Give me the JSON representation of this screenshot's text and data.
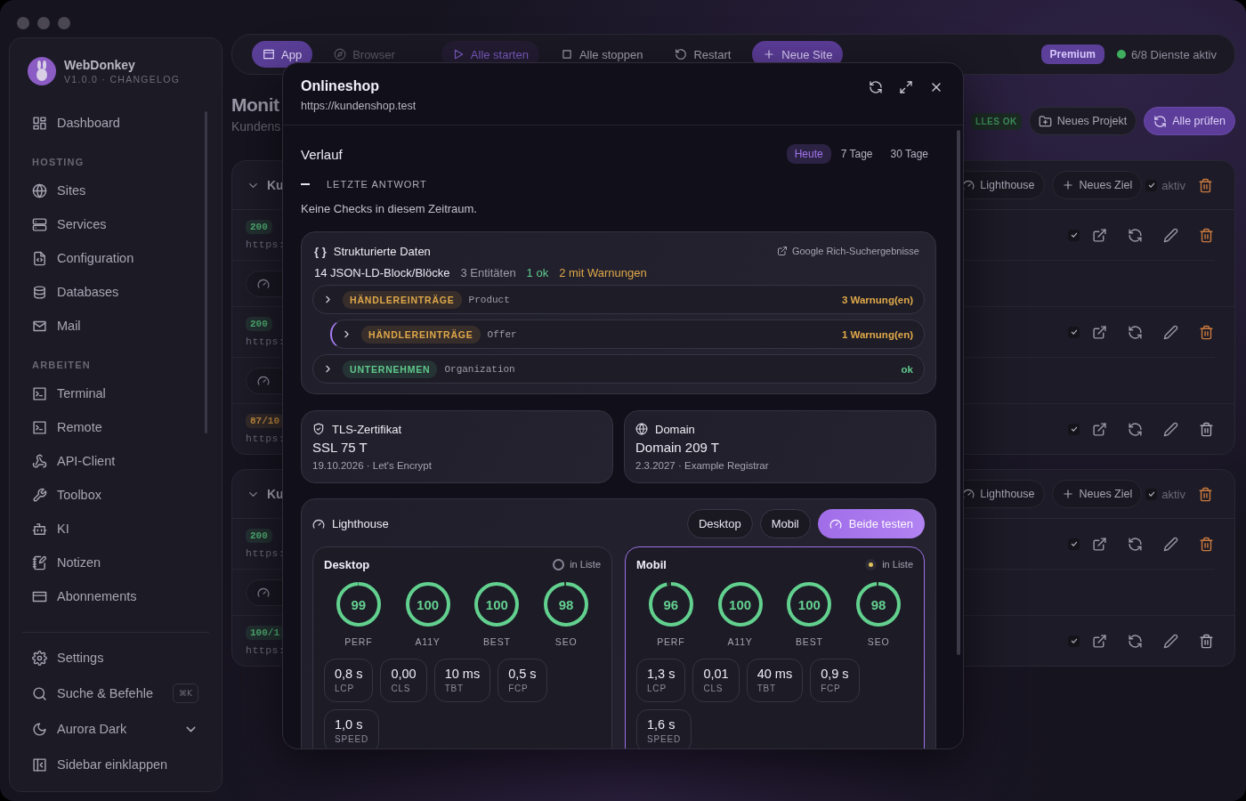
{
  "sidebar": {
    "app_name": "WebDonkey",
    "version": "V1.0.0 · CHANGELOG",
    "sections": [
      {
        "items": [
          {
            "label": "Dashboard"
          }
        ]
      },
      {
        "title": "HOSTING",
        "items": [
          {
            "label": "Sites"
          },
          {
            "label": "Services"
          },
          {
            "label": "Configuration"
          },
          {
            "label": "Databases"
          },
          {
            "label": "Mail"
          }
        ]
      },
      {
        "title": "ARBEITEN",
        "items": [
          {
            "label": "Terminal"
          },
          {
            "label": "Remote"
          },
          {
            "label": "API-Client"
          },
          {
            "label": "Toolbox"
          },
          {
            "label": "KI"
          },
          {
            "label": "Notizen"
          },
          {
            "label": "Abonnements"
          }
        ]
      }
    ],
    "footer": [
      {
        "label": "Settings"
      },
      {
        "label": "Suche & Befehle",
        "shortcut": "⌘K"
      },
      {
        "label": "Aurora Dark",
        "dropdown": true
      },
      {
        "label": "Sidebar einklappen"
      }
    ]
  },
  "toolbar": {
    "segments": [
      {
        "label": "App",
        "selected": true
      },
      {
        "label": "Browser",
        "selected": false
      }
    ],
    "actions": [
      {
        "label": "Alle starten",
        "kind": "accent"
      },
      {
        "label": "Alle stoppen",
        "kind": "plain"
      },
      {
        "label": "Restart",
        "kind": "plain"
      },
      {
        "label": "Neue Site",
        "kind": "primary"
      }
    ],
    "plan": "Premium",
    "services": "6/8 Dienste aktiv"
  },
  "page": {
    "title": "Monit",
    "subtitle": "Kundens",
    "status": "LLES OK",
    "buttons": [
      {
        "label": "Neues Projekt",
        "kind": "outline"
      },
      {
        "label": "Alle prüfen",
        "kind": "primary"
      }
    ]
  },
  "groups": [
    {
      "title": "Ku",
      "lighthouse": "Lighthouse",
      "new_target": "Neues Ziel",
      "active_label": "aktiv",
      "active": true,
      "rows": [
        {
          "badge": {
            "text": "200",
            "color": "#4fae72"
          },
          "url": "https:",
          "meter_button": true,
          "checked": true,
          "trash": {
            "color": "#c97a3f"
          }
        },
        {
          "badge": {
            "text": "200",
            "color": "#4fae72"
          },
          "url": "https:",
          "meter_button": true,
          "checked": true,
          "trash": {
            "color": "#c97a3f"
          }
        },
        {
          "badge": {
            "text": "87/10",
            "color": "#c08a3e"
          },
          "url": "https:",
          "meter_button": false,
          "checked": true,
          "trash": {
            "color": "#a8a5b3"
          }
        }
      ]
    },
    {
      "title": "Ku",
      "lighthouse": "Lighthouse",
      "new_target": "Neues Ziel",
      "active_label": "aktiv",
      "active": true,
      "rows": [
        {
          "badge": {
            "text": "200",
            "color": "#4fae72"
          },
          "url": "https:",
          "meter_button": true,
          "checked": true,
          "trash": {
            "color": "#c97a3f"
          }
        },
        {
          "badge": {
            "text": "100/1",
            "color": "#4fae72"
          },
          "url": "https:",
          "meter_button": false,
          "checked": true,
          "trash": {
            "color": "#a8a5b3"
          }
        }
      ]
    }
  ],
  "modal": {
    "title": "Onlineshop",
    "url": "https://kundenshop.test",
    "history": {
      "title": "Verlauf",
      "ranges": [
        {
          "label": "Heute",
          "selected": true
        },
        {
          "label": "7 Tage",
          "selected": false
        },
        {
          "label": "30 Tage",
          "selected": false
        }
      ],
      "legend": "LETZTE ANTWORT",
      "empty": "Keine Checks in diesem Zeitraum."
    },
    "structured_data": {
      "icon": "{ }",
      "title": "Strukturierte Daten",
      "link": "Google Rich-Suchergebnisse",
      "summary": [
        {
          "text": "14 JSON-LD-Block/Blöcke",
          "color": "#e9e7f1"
        },
        {
          "text": "3 Entitäten",
          "color": "#9e9bab"
        },
        {
          "text": "1 ok",
          "color": "#5fc98b"
        },
        {
          "text": "2 mit Warnungen",
          "color": "#e0a84a"
        }
      ],
      "entities": [
        {
          "label": "HÄNDLEREINTRÄGE",
          "type": "Product",
          "status": "3 Warnung(en)",
          "color": "#e0a84a",
          "children": [
            {
              "label": "HÄNDLEREINTRÄGE",
              "type": "Offer",
              "status": "1 Warnung(en)",
              "color": "#e0a84a"
            }
          ]
        },
        {
          "label": "UNTERNEHMEN",
          "type": "Organization",
          "status": "ok",
          "color": "#5fc98b"
        }
      ]
    },
    "certificates": [
      {
        "title": "TLS-Zertifikat",
        "value": "SSL 75 T",
        "detail": "19.10.2026 · Let's Encrypt"
      },
      {
        "title": "Domain",
        "value": "Domain 209 T",
        "detail": "2.3.2027 · Example Registrar"
      }
    ],
    "lighthouse": {
      "title": "Lighthouse",
      "buttons": [
        {
          "label": "Desktop",
          "kind": "outline"
        },
        {
          "label": "Mobil",
          "kind": "outline"
        },
        {
          "label": "Beide testen",
          "kind": "primary"
        }
      ],
      "panels": [
        {
          "title": "Desktop",
          "selected": false,
          "list_label": "in Liste",
          "scores": [
            {
              "value": "99",
              "label": "PERF",
              "level": 0.99
            },
            {
              "value": "100",
              "label": "A11Y",
              "level": 1
            },
            {
              "value": "100",
              "label": "BEST",
              "level": 1
            },
            {
              "value": "98",
              "label": "SEO",
              "level": 0.98
            }
          ],
          "metrics": [
            {
              "value": "0,8 s",
              "label": "LCP"
            },
            {
              "value": "0,00",
              "label": "CLS"
            },
            {
              "value": "10 ms",
              "label": "TBT"
            },
            {
              "value": "0,5 s",
              "label": "FCP"
            },
            {
              "value": "1,0 s",
              "label": "SPEED"
            }
          ]
        },
        {
          "title": "Mobil",
          "selected": true,
          "list_label": "in Liste",
          "scores": [
            {
              "value": "96",
              "label": "PERF",
              "level": 0.96
            },
            {
              "value": "100",
              "label": "A11Y",
              "level": 1
            },
            {
              "value": "100",
              "label": "BEST",
              "level": 1
            },
            {
              "value": "98",
              "label": "SEO",
              "level": 0.98
            }
          ],
          "metrics": [
            {
              "value": "1,3 s",
              "label": "LCP"
            },
            {
              "value": "0,01",
              "label": "CLS"
            },
            {
              "value": "40 ms",
              "label": "TBT"
            },
            {
              "value": "0,9 s",
              "label": "FCP"
            },
            {
              "value": "1,6 s",
              "label": "SPEED"
            }
          ]
        }
      ]
    }
  }
}
